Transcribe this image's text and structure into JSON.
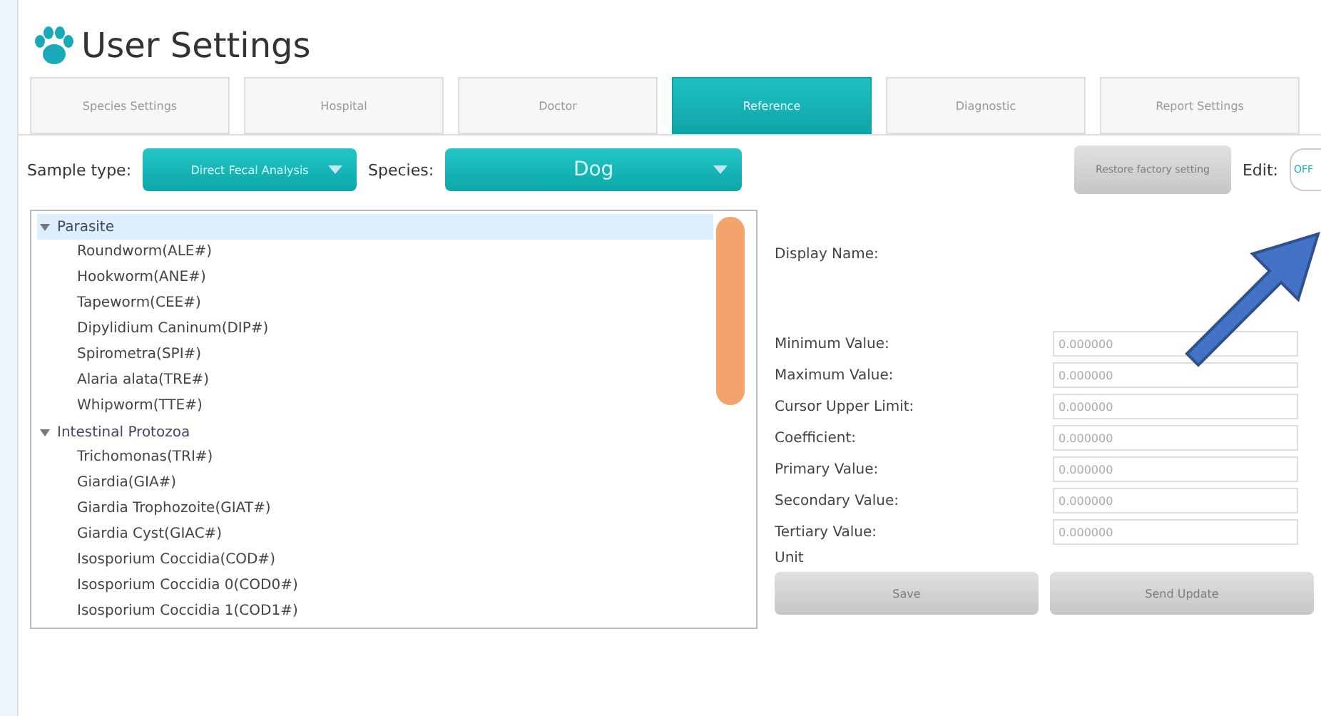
{
  "window": {
    "title": "User Settings"
  },
  "tabs": [
    {
      "label": "Species Settings",
      "selected": false
    },
    {
      "label": "Hospital",
      "selected": false
    },
    {
      "label": "Doctor",
      "selected": false
    },
    {
      "label": "Reference",
      "selected": true
    },
    {
      "label": "Diagnostic",
      "selected": false
    },
    {
      "label": "Report Settings",
      "selected": false
    }
  ],
  "toolbar": {
    "sample_type_label": "Sample type:",
    "sample_type": "Direct Fecal Analysis",
    "species_label": "Species:",
    "species": "Dog",
    "restore_button": {
      "label": "Restore factory setting",
      "disabled": true
    },
    "edit_label": "Edit:",
    "edit_toggle": {
      "label": "OFF",
      "on": false
    }
  },
  "tree": [
    {
      "label": "Parasite",
      "expanded": true,
      "selected": true,
      "children": [
        {
          "label": "Roundworm(ALE#)"
        },
        {
          "label": "Hookworm(ANE#)"
        },
        {
          "label": "Tapeworm(CEE#)"
        },
        {
          "label": "Dipylidium Caninum(DIP#)"
        },
        {
          "label": "Spirometra(SPI#)"
        },
        {
          "label": "Alaria alata(TRE#)"
        },
        {
          "label": "Whipworm(TTE#)"
        }
      ]
    },
    {
      "label": "Intestinal Protozoa",
      "expanded": true,
      "selected": false,
      "children": [
        {
          "label": "Trichomonas(TRI#)"
        },
        {
          "label": "Giardia(GIA#)"
        },
        {
          "label": "Giardia Trophozoite(GIAT#)"
        },
        {
          "label": "Giardia Cyst(GIAC#)"
        },
        {
          "label": "Isosporium Coccidia(COD#)"
        },
        {
          "label": "Isosporium Coccidia 0(COD0#)"
        },
        {
          "label": "Isosporium Coccidia 1(COD1#)"
        }
      ]
    }
  ],
  "details": {
    "display_name_label": "Display Name:",
    "fields": [
      {
        "label": "Minimum Value:",
        "value": "0.000000"
      },
      {
        "label": "Maximum Value:",
        "value": "0.000000"
      },
      {
        "label": "Cursor Upper Limit:",
        "value": "0.000000"
      },
      {
        "label": "Coefficient:",
        "value": "0.000000"
      },
      {
        "label": "Primary Value:",
        "value": "0.000000"
      },
      {
        "label": "Secondary Value:",
        "value": "0.000000"
      },
      {
        "label": "Tertiary Value:",
        "value": "0.000000"
      }
    ],
    "unit_label": "Unit",
    "buttons": [
      {
        "label": "Save",
        "disabled": true
      },
      {
        "label": "Send Update",
        "disabled": true
      }
    ]
  }
}
